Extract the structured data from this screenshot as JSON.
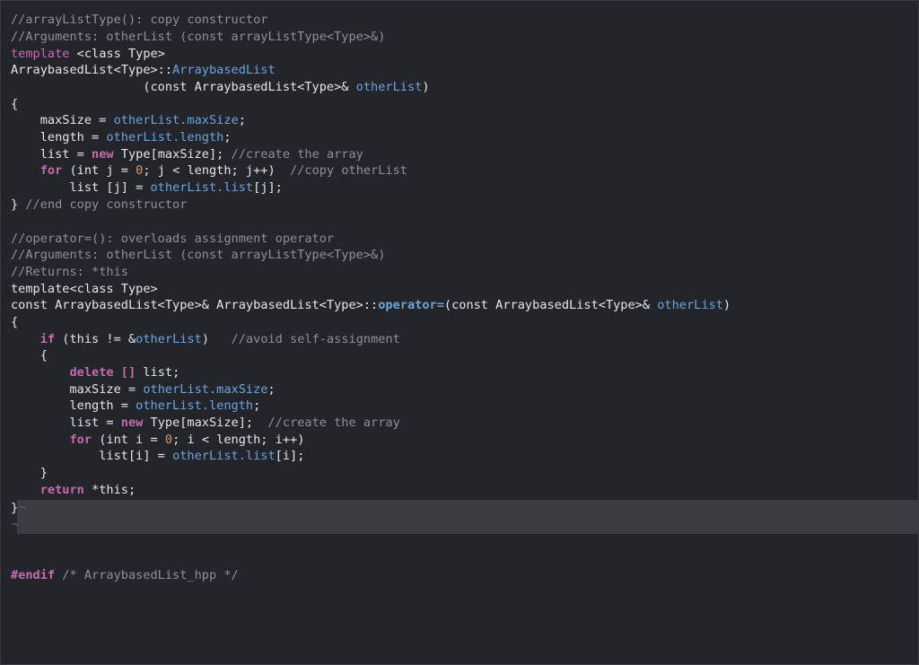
{
  "editor": {
    "language": "C++",
    "theme": {
      "background": "#24242b",
      "comment": "#8f8f9c",
      "keyword": "#c76bb0",
      "member": "#6aa5de",
      "number": "#d69a6a",
      "highlight": "#3b3b42"
    },
    "code": {
      "l1": "//arrayListType(): copy constructor",
      "l2": "//Arguments: otherList (const arrayListType<Type>&)",
      "l3a": "template",
      "l3b": " <class Type>",
      "l4a": "ArraybasedList<Type>::",
      "l4b": "ArraybasedList",
      "l5a": "                  (const ArraybasedList<Type>& ",
      "l5b": "otherList",
      "l5c": ")",
      "l6": "{",
      "l7a": "    maxSize = ",
      "l7b": "otherList.maxSize",
      "l7c": ";",
      "l8a": "    length = ",
      "l8b": "otherList.length",
      "l8c": ";",
      "l9a": "    list = ",
      "l9b": "new",
      "l9c": " Type[maxSize]; ",
      "l9d": "//create the array",
      "l10a": "    ",
      "l10b": "for",
      "l10c": " (int j = ",
      "l10d": "0",
      "l10e": "; j < length; j++)  ",
      "l10f": "//copy otherList",
      "l11a": "        list [j] = ",
      "l11b": "otherList.list",
      "l11c": "[j];",
      "l12a": "} ",
      "l12b": "//end copy constructor",
      "l14": "//operator=(): overloads assignment operator",
      "l15": "//Arguments: otherList (const arrayListType<Type>&)",
      "l16": "//Returns: *this",
      "l17": "template<class Type>",
      "l18a": "const ArraybasedList<Type>& ArraybasedList<Type>::",
      "l18b": "operator=",
      "l18c": "(const ArraybasedList<Type>& ",
      "l18d": "otherList",
      "l18e": ")",
      "l19": "{",
      "l20a": "    ",
      "l20b": "if",
      "l20c": " (this != &",
      "l20d": "otherList",
      "l20e": ")   ",
      "l20f": "//avoid self-assignment",
      "l21": "    {",
      "l22a": "        ",
      "l22b": "delete [] ",
      "l22c": "list;",
      "l23a": "        maxSize = ",
      "l23b": "otherList.maxSize",
      "l23c": ";",
      "l24a": "        length = ",
      "l24b": "otherList.length",
      "l24c": ";",
      "l25a": "        list = ",
      "l25b": "new",
      "l25c": " Type[maxSize];  ",
      "l25d": "//create the array",
      "l26a": "        ",
      "l26b": "for",
      "l26c": " (int i = ",
      "l26d": "0",
      "l26e": "; i < length; i++)",
      "l27a": "            list[i] = ",
      "l27b": "otherList.list",
      "l27c": "[i];",
      "l28": "    }",
      "l29a": "    ",
      "l29b": "return",
      "l29c": " *this;",
      "l30a": "}",
      "l30b": "¬",
      "l31": "¬",
      "l34a": "#endif",
      "l34b": " /* ArraybasedList_hpp */"
    }
  }
}
